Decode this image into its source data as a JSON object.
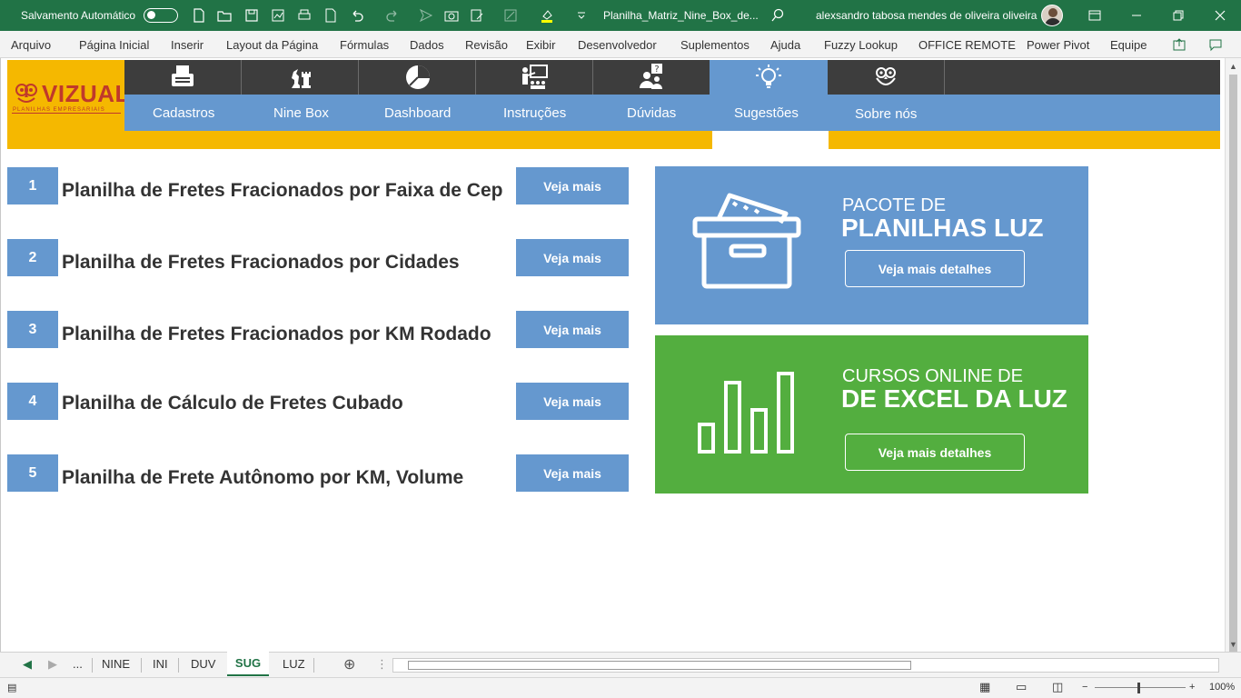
{
  "titlebar": {
    "autosave_label": "Salvamento Automático",
    "file_name": "Planilha_Matriz_Nine_Box_de...",
    "user_name": "alexsandro tabosa mendes de oliveira oliveira"
  },
  "menu": [
    "Arquivo",
    "Página Inicial",
    "Inserir",
    "Layout da Página",
    "Fórmulas",
    "Dados",
    "Revisão",
    "Exibir",
    "Desenvolvedor",
    "Suplementos",
    "Ajuda",
    "Fuzzy Lookup",
    "OFFICE REMOTE",
    "Power Pivot",
    "Equipe"
  ],
  "logo": {
    "name": "VIZUAL",
    "tagline": "PLANILHAS EMPRESARIAIS"
  },
  "nav": [
    {
      "label": "Cadastros",
      "icon": "typewriter-icon"
    },
    {
      "label": "Nine Box",
      "icon": "chess-icon"
    },
    {
      "label": "Dashboard",
      "icon": "pie-chart-icon"
    },
    {
      "label": "Instruções",
      "icon": "teacher-board-icon"
    },
    {
      "label": "Dúvidas",
      "icon": "question-people-icon"
    },
    {
      "label": "Sugestões",
      "icon": "lightbulb-icon"
    },
    {
      "label": "Sobre nós",
      "icon": "owl-icon"
    }
  ],
  "active_nav": "Sugestões",
  "items": [
    {
      "number": "1",
      "title": "Planilha de Fretes Fracionados por Faixa de Cep",
      "button": "Veja mais"
    },
    {
      "number": "2",
      "title": "Planilha de Fretes Fracionados por Cidades",
      "button": "Veja mais"
    },
    {
      "number": "3",
      "title": "Planilha de Fretes Fracionados por KM Rodado",
      "button": "Veja mais"
    },
    {
      "number": "4",
      "title": "Planilha de Cálculo de Fretes Cubado",
      "button": "Veja mais"
    },
    {
      "number": "5",
      "title": "Planilha de Frete Autônomo por KM, Volume",
      "button": "Veja mais"
    }
  ],
  "cards": {
    "pacote": {
      "kicker": "PACOTE DE",
      "headline": "PLANILHAS LUZ",
      "button": "Veja mais detalhes",
      "icon": "archive-box-icon"
    },
    "cursos": {
      "kicker": "CURSOS ONLINE DE",
      "headline": "DE EXCEL DA LUZ",
      "button": "Veja mais detalhes",
      "icon": "bar-chart-icon"
    }
  },
  "sheet_tabs": {
    "ellipsis": "...",
    "tabs": [
      "NINE",
      "INI",
      "DUV",
      "SUG",
      "LUZ"
    ],
    "active": "SUG"
  },
  "status": {
    "zoom": "100%"
  },
  "colors": {
    "excel_green": "#217346",
    "nav_blue": "#6598cf",
    "nav_dark": "#3d3d3d",
    "brand_yellow": "#f5b800",
    "promo_green": "#53ae3f",
    "logo_red": "#c0392b"
  }
}
